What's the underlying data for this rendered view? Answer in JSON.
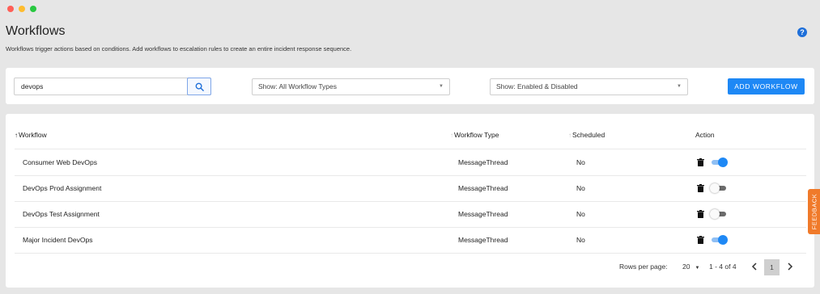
{
  "page": {
    "title": "Workflows",
    "subtitle": "Workflows trigger actions based on conditions. Add workflows to escalation rules to create an entire incident response sequence.",
    "help_icon": "?"
  },
  "filters": {
    "search_value": "devops",
    "search_icon": "search-icon",
    "workflow_type_select": "Show: All Workflow Types",
    "state_select": "Show: Enabled & Disabled",
    "add_button": "ADD WORKFLOW"
  },
  "table": {
    "columns": [
      "Workflow",
      "Workflow Type",
      "Scheduled",
      "Action"
    ],
    "sort_column": "Workflow",
    "rows": [
      {
        "name": "Consumer Web DevOps",
        "type": "MessageThread",
        "scheduled": "No",
        "enabled": true
      },
      {
        "name": "DevOps Prod Assignment",
        "type": "MessageThread",
        "scheduled": "No",
        "enabled": false
      },
      {
        "name": "DevOps Test Assignment",
        "type": "MessageThread",
        "scheduled": "No",
        "enabled": false
      },
      {
        "name": "Major Incident DevOps",
        "type": "MessageThread",
        "scheduled": "No",
        "enabled": true
      }
    ]
  },
  "pagination": {
    "rows_per_page_label": "Rows per page:",
    "rows_per_page": "20",
    "range": "1 - 4 of 4",
    "current_page": "1"
  },
  "feedback": {
    "label": "FEEDBACK"
  },
  "colors": {
    "accent": "#1e88f5",
    "feedback": "#f07a2a",
    "toggle_on_track": "#8fbff4",
    "toggle_off_track": "#6b6b6b"
  }
}
